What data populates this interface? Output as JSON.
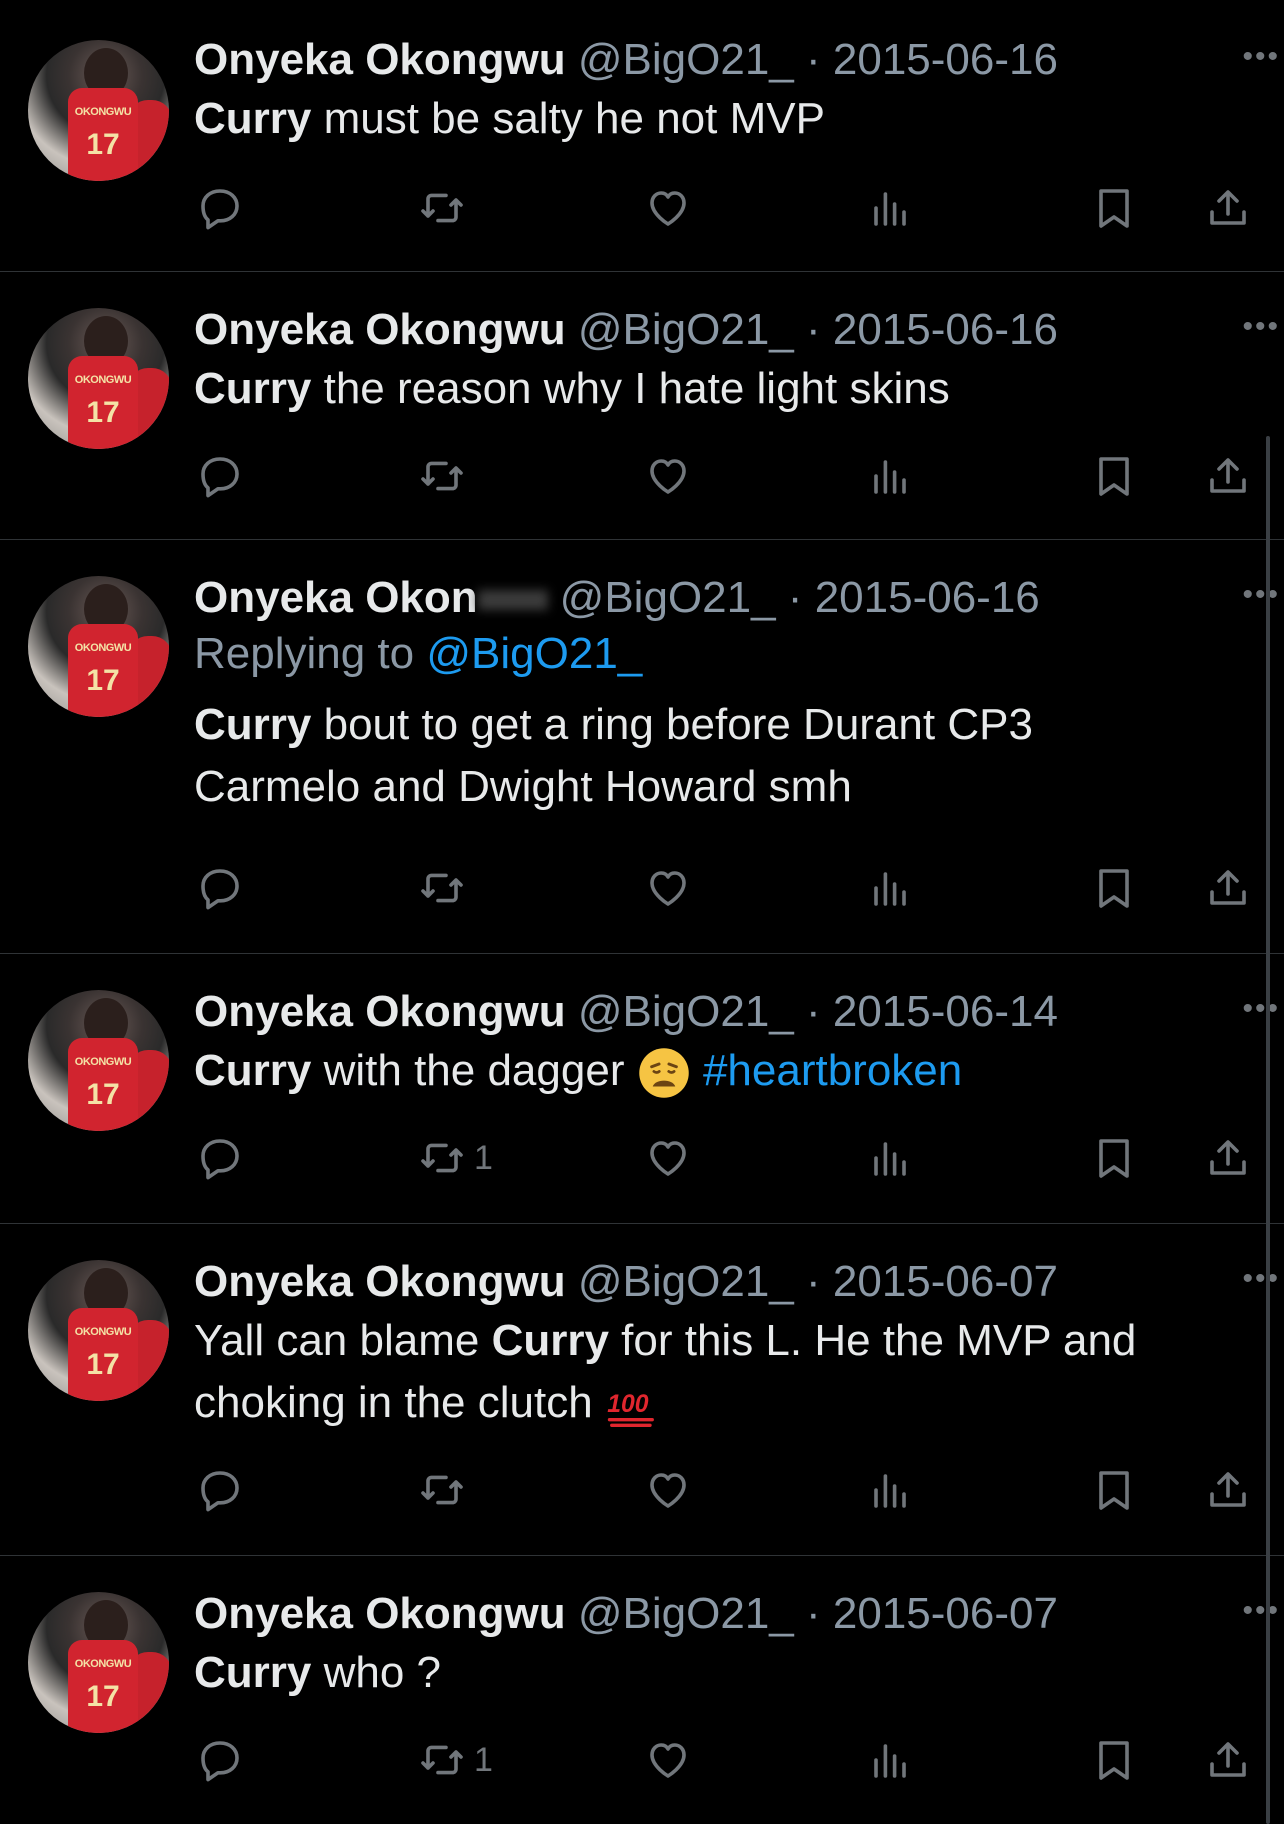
{
  "tweets": [
    {
      "name": "Onyeka Okongwu",
      "handle": "@BigO21_",
      "date": "2015-06-16",
      "reply_to": "",
      "reply_prefix": "",
      "text_bold": "Curry",
      "text_rest": " must be salty he not MVP",
      "retweets": "",
      "emoji": ""
    },
    {
      "name": "Onyeka Okongwu",
      "handle": "@BigO21_",
      "date": "2015-06-16",
      "reply_to": "",
      "reply_prefix": "",
      "text_bold": "Curry",
      "text_rest": " the reason why I hate light skins",
      "retweets": "",
      "emoji": ""
    },
    {
      "name": "Onyeka Okon",
      "handle": "@BigO21_",
      "date": "2015-06-16",
      "reply_prefix": "Replying to ",
      "reply_to": "@BigO21_",
      "text_bold": "Curry",
      "text_rest": " bout to get a ring before Durant CP3",
      "text_line2": "Carmelo and Dwight Howard smh",
      "retweets": "",
      "emoji": ""
    },
    {
      "name": "Onyeka Okongwu",
      "handle": "@BigO21_",
      "date": "2015-06-14",
      "reply_to": "",
      "reply_prefix": "",
      "text_bold": "Curry",
      "text_rest": " with the dagger ",
      "hashtag": "#heartbroken",
      "retweets": "1",
      "emoji": "weary-face"
    },
    {
      "name": "Onyeka Okongwu",
      "handle": "@BigO21_",
      "date": "2015-06-07",
      "reply_to": "",
      "reply_prefix": "",
      "text_pre": "Yall can blame ",
      "text_bold": "Curry",
      "text_rest": " for this L. He the MVP and",
      "text_line2": "choking in the clutch ",
      "retweets": "",
      "emoji": "hundred-points"
    },
    {
      "name": "Onyeka Okongwu",
      "handle": "@BigO21_",
      "date": "2015-06-07",
      "reply_to": "",
      "reply_prefix": "",
      "text_bold": "Curry",
      "text_rest": " who ?",
      "retweets": "1",
      "emoji": ""
    }
  ],
  "avatar_text": {
    "name": "OKONGWU",
    "number": "17"
  },
  "separator": " · ",
  "more_glyph": "•••",
  "colors": {
    "background": "#000000",
    "text": "#e7e9ea",
    "muted": "#8b98a5",
    "link": "#1d9bf0",
    "divider": "#2f3336"
  },
  "icons": [
    "reply-icon",
    "retweet-icon",
    "like-icon",
    "views-icon",
    "bookmark-icon",
    "share-icon"
  ]
}
